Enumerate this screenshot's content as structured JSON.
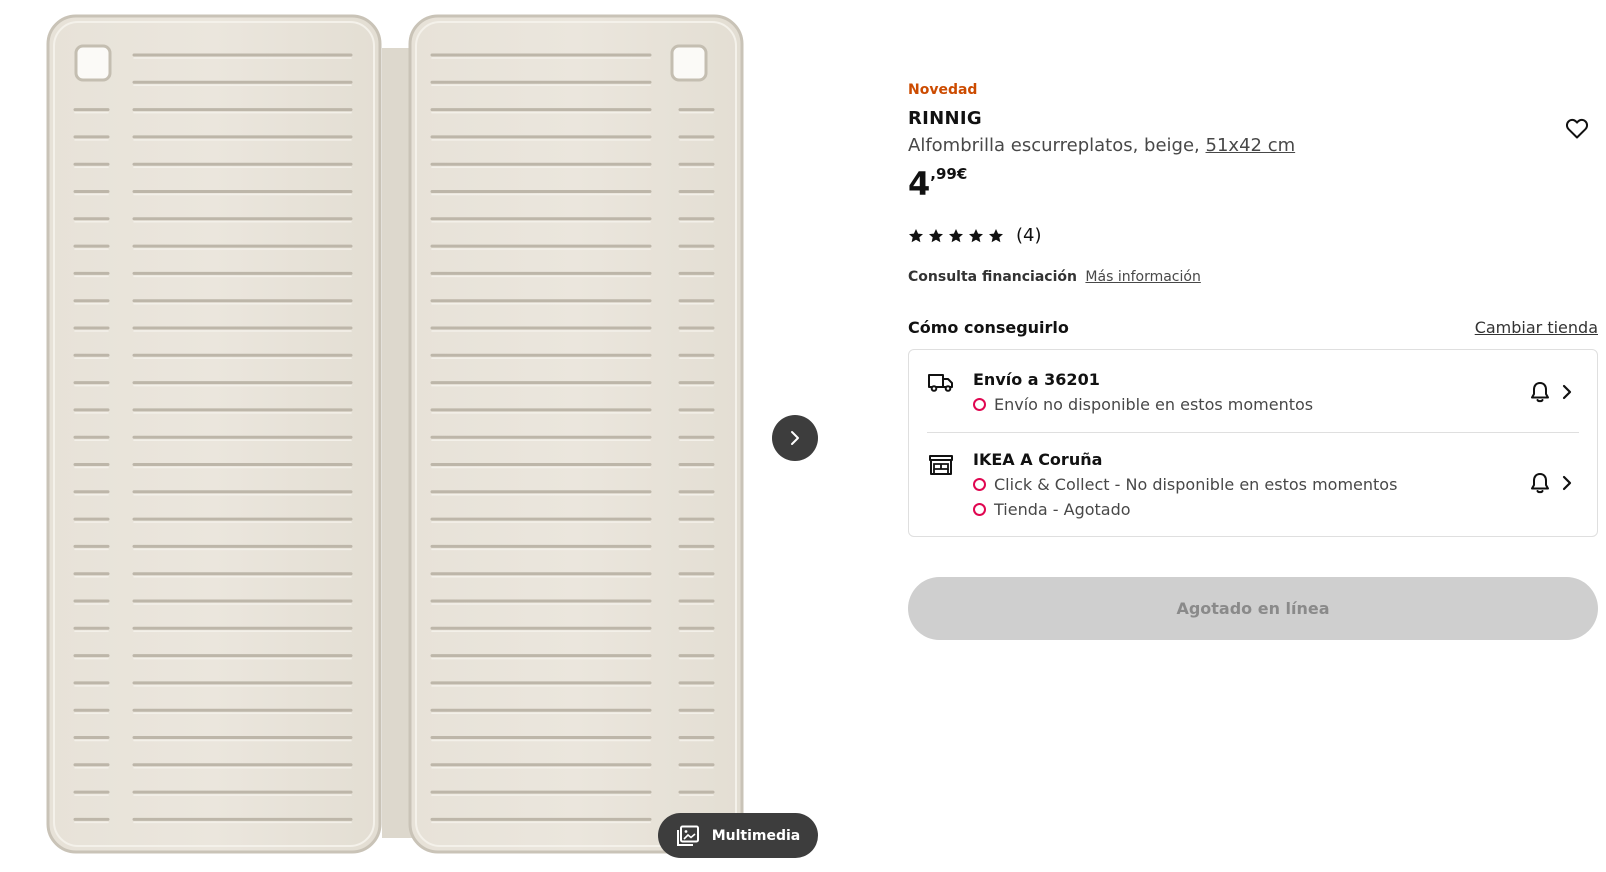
{
  "product": {
    "badge": "Novedad",
    "name": "RINNIG",
    "description": "Alfombrilla escurreplatos, beige,",
    "size": "51x42 cm",
    "price_integer": "4",
    "price_decimal": ",99€",
    "rating": {
      "stars": 5,
      "count": "(4)"
    },
    "finance": {
      "label": "Consulta financiación",
      "link": "Más información"
    }
  },
  "gallery": {
    "next_icon": "chevron-right-icon",
    "media_label": "Multimedia",
    "media_icon": "gallery-icon"
  },
  "availability": {
    "title": "Cómo conseguirlo",
    "change_store": "Cambiar tienda",
    "delivery": {
      "icon": "truck-icon",
      "title": "Envío a 36201",
      "status": "Envío no disponible en estos momentos"
    },
    "store": {
      "icon": "store-icon",
      "title": "IKEA A Coruña",
      "status_collect": "Click & Collect - No disponible en estos momentos",
      "status_store": "Tienda - Agotado"
    },
    "status_color": "#e00751"
  },
  "buy_button": "Agotado en línea",
  "colors": {
    "badge": "#cc4b00",
    "button_disabled": "#cfcfcf",
    "dark_button": "#3d3d3d"
  }
}
